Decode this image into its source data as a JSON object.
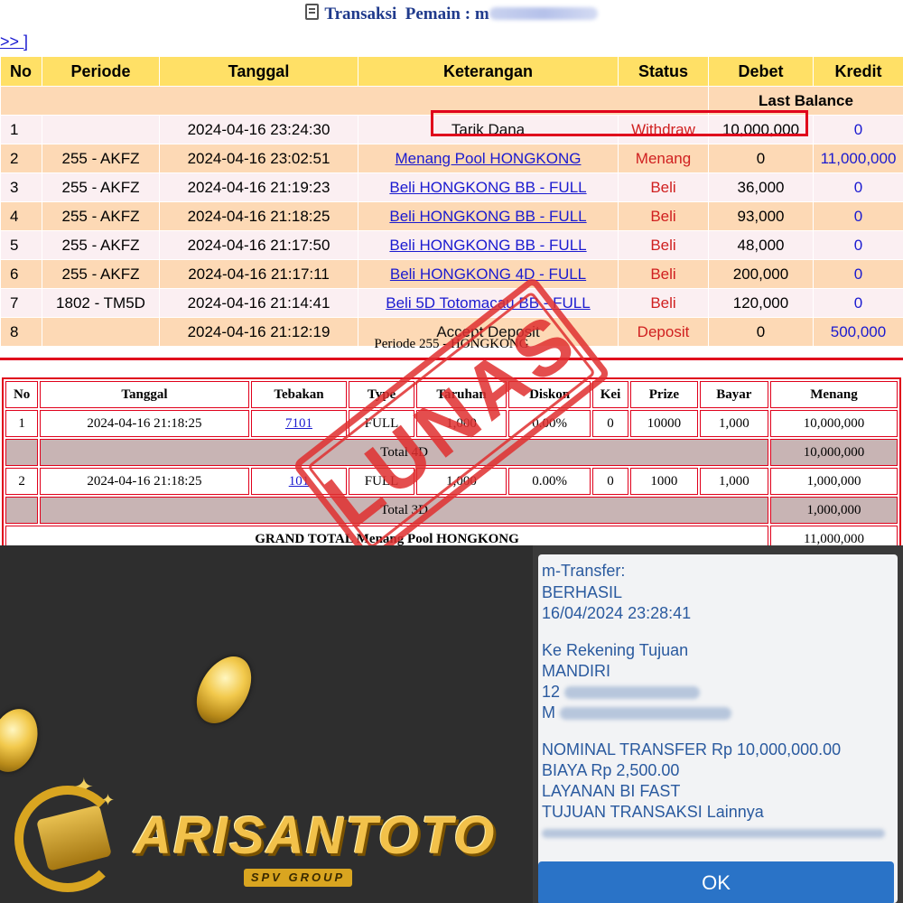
{
  "header": {
    "title": "Transaksi",
    "player_label": "Pemain :",
    "player_visible": "m",
    "nav_link": ">> ]"
  },
  "transactions": {
    "columns": [
      "No",
      "Periode",
      "Tanggal",
      "Keterangan",
      "Status",
      "Debet",
      "Kredit"
    ],
    "last_balance_label": "Last Balance",
    "rows": [
      {
        "no": "1",
        "periode": "",
        "tanggal": "2024-04-16 23:24:30",
        "keterangan": "Tarik Dana",
        "status": "Withdraw",
        "debet": "10,000,000",
        "kredit": "0"
      },
      {
        "no": "2",
        "periode": "255 - AKFZ",
        "tanggal": "2024-04-16 23:02:51",
        "keterangan": "Menang Pool HONGKONG",
        "status": "Menang",
        "debet": "0",
        "kredit": "11,000,000"
      },
      {
        "no": "3",
        "periode": "255 - AKFZ",
        "tanggal": "2024-04-16 21:19:23",
        "keterangan": "Beli HONGKONG BB - FULL",
        "status": "Beli",
        "debet": "36,000",
        "kredit": "0"
      },
      {
        "no": "4",
        "periode": "255 - AKFZ",
        "tanggal": "2024-04-16 21:18:25",
        "keterangan": "Beli HONGKONG BB - FULL",
        "status": "Beli",
        "debet": "93,000",
        "kredit": "0"
      },
      {
        "no": "5",
        "periode": "255 - AKFZ",
        "tanggal": "2024-04-16 21:17:50",
        "keterangan": "Beli HONGKONG BB - FULL",
        "status": "Beli",
        "debet": "48,000",
        "kredit": "0"
      },
      {
        "no": "6",
        "periode": "255 - AKFZ",
        "tanggal": "2024-04-16 21:17:11",
        "keterangan": "Beli HONGKONG 4D - FULL",
        "status": "Beli",
        "debet": "200,000",
        "kredit": "0"
      },
      {
        "no": "7",
        "periode": "1802 - TM5D",
        "tanggal": "2024-04-16 21:14:41",
        "keterangan": "Beli 5D Totomacau BB - FULL",
        "status": "Beli",
        "debet": "120,000",
        "kredit": "0"
      },
      {
        "no": "8",
        "periode": "",
        "tanggal": "2024-04-16 21:12:19",
        "keterangan": "Accept Deposit",
        "status": "Deposit",
        "debet": "0",
        "kredit": "500,000"
      }
    ]
  },
  "periode_caption": "Periode 255 - HONGKONG",
  "detail": {
    "columns": [
      "No",
      "Tanggal",
      "Tebakan",
      "Type",
      "Taruhan",
      "Diskon",
      "Kei",
      "Prize",
      "Bayar",
      "Menang"
    ],
    "rows": [
      {
        "no": "1",
        "tanggal": "2024-04-16 21:18:25",
        "tebakan": "7101",
        "type": "FULL",
        "taruhan": "1,000",
        "diskon": "0.00%",
        "kei": "0",
        "prize": "10000",
        "bayar": "1,000",
        "menang": "10,000,000"
      },
      {
        "no": "2",
        "tanggal": "2024-04-16 21:18:25",
        "tebakan": "101",
        "type": "FULL",
        "taruhan": "1,000",
        "diskon": "0.00%",
        "kei": "0",
        "prize": "1000",
        "bayar": "1,000",
        "menang": "1,000,000"
      }
    ],
    "total_4d_label": "Total 4D",
    "total_4d_value": "10,000,000",
    "total_3d_label": "Total 3D",
    "total_3d_value": "1,000,000",
    "grand_total_label": "GRAND TOTAL  Menang Pool HONGKONG",
    "grand_total_value": "11,000,000"
  },
  "stamp": {
    "text": "LUNAS"
  },
  "logo": {
    "text": "ARISANTOTO",
    "sub": "SPV GROUP"
  },
  "receipt": {
    "line1": "m-Transfer:",
    "line2": "BERHASIL",
    "line3": "16/04/2024 23:28:41",
    "line4": "Ke Rekening Tujuan",
    "line5": "MANDIRI",
    "line6": "12",
    "line7": "M",
    "line8": "NOMINAL TRANSFER Rp 10,000,000.00",
    "line9": "BIAYA Rp 2,500.00",
    "line10": "LAYANAN BI FAST",
    "line11": "TUJUAN TRANSAKSI Lainnya",
    "ok_button": "OK"
  },
  "colors": {
    "header_yellow": "#ffe066",
    "row_peach": "#fdd9b5",
    "row_pink": "#fbeff2",
    "link_blue": "#1a1ad0",
    "status_red": "#d02020",
    "stamp_red": "#e03030",
    "receipt_blue": "#2a5a9f",
    "ok_blue": "#2a73c7"
  }
}
